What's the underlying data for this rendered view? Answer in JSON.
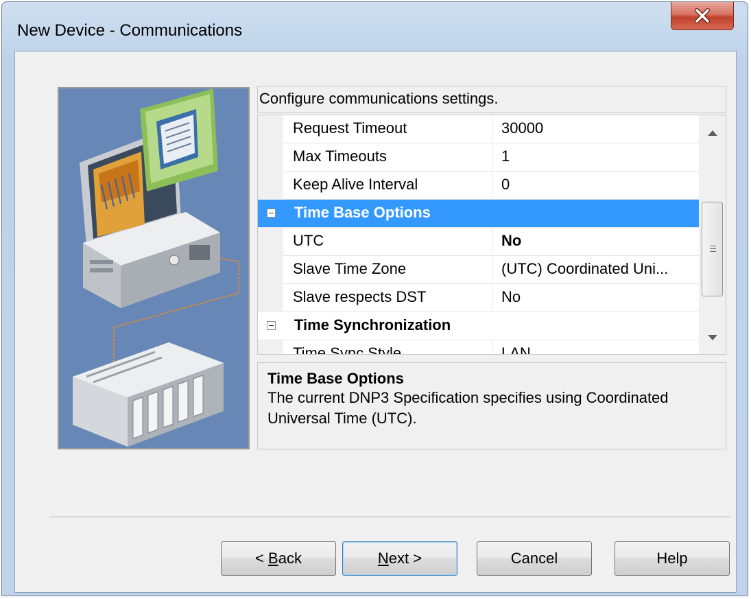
{
  "window": {
    "title": "New Device - Communications"
  },
  "hint": "Configure communications settings.",
  "properties": [
    {
      "name": "Request Timeout",
      "value": "30000"
    },
    {
      "name": "Max Timeouts",
      "value": "1"
    },
    {
      "name": "Keep Alive Interval",
      "value": "0"
    },
    {
      "category": "Time Base Options",
      "selected": true
    },
    {
      "name": "UTC",
      "value": "No",
      "bold_value": true
    },
    {
      "name": "Slave Time Zone",
      "value": "(UTC) Coordinated Uni..."
    },
    {
      "name": "Slave respects DST",
      "value": "No"
    },
    {
      "category": "Time Synchronization"
    },
    {
      "name": "Time Sync Style",
      "value": "LAN"
    }
  ],
  "description": {
    "title": "Time Base Options",
    "text": "The current DNP3 Specification specifies using Coordinated Universal Time (UTC)."
  },
  "buttons": {
    "back": {
      "prefix": "< ",
      "mnemonic": "B",
      "rest": "ack"
    },
    "next": {
      "mnemonic": "N",
      "rest": "ext >"
    },
    "cancel": "Cancel",
    "help": "Help"
  },
  "colors": {
    "selection": "#3399ff",
    "banner_bg": "#6788b6",
    "close_button": "#c7432d"
  },
  "icons": [
    "close-icon",
    "collapse-icon",
    "scroll-up-icon",
    "scroll-down-icon",
    "scroll-grip-icon"
  ]
}
